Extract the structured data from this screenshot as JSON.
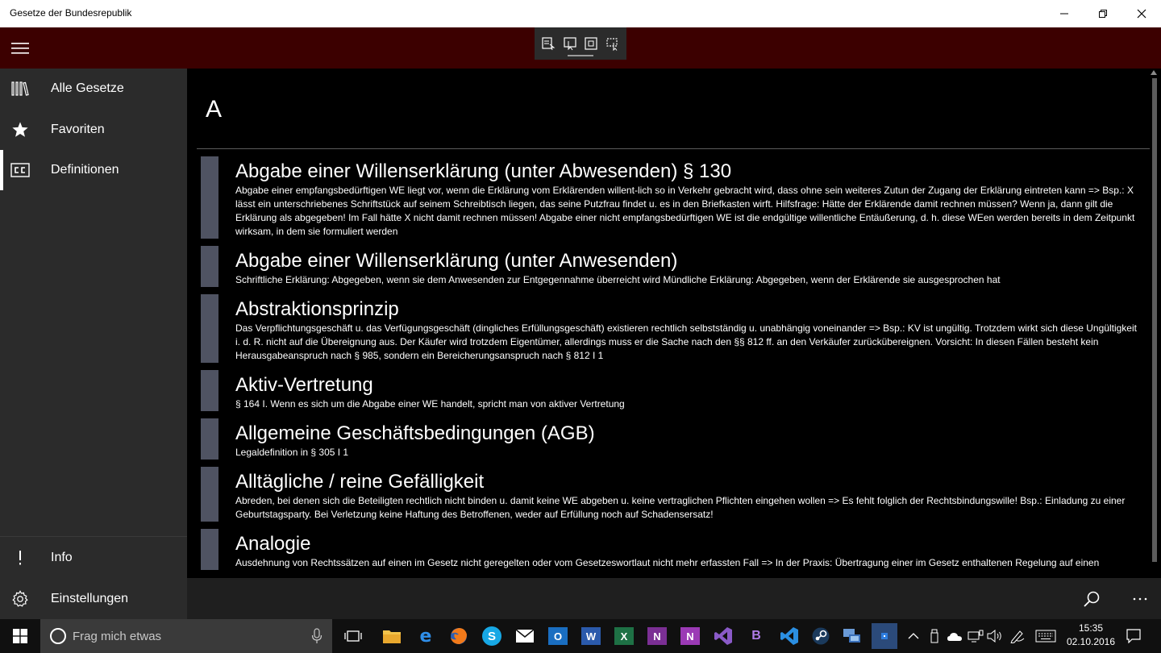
{
  "window": {
    "title": "Gesetze der Bundesrepublik"
  },
  "sidebar": {
    "items": [
      {
        "label": "Alle Gesetze",
        "icon": "library-icon"
      },
      {
        "label": "Favoriten",
        "icon": "star-icon"
      },
      {
        "label": "Definitionen",
        "icon": "closed-caption-icon",
        "active": true
      }
    ],
    "footer": [
      {
        "label": "Info",
        "icon": "info-icon"
      },
      {
        "label": "Einstellungen",
        "icon": "gear-icon"
      }
    ]
  },
  "main": {
    "section_letter": "A",
    "entries": [
      {
        "title": "Abgabe einer Willenserklärung (unter Abwesenden) § 130",
        "description": "Abgabe einer empfangsbedürftigen WE liegt vor, wenn die Erklärung vom Erklärenden willent-lich so in Verkehr gebracht wird, dass ohne sein weiteres Zutun der Zugang der Erklärung eintreten kann => Bsp.: X lässt ein unterschriebenes Schriftstück auf seinem Schreibtisch liegen, das seine Putzfrau findet u. es in den Briefkasten wirft. Hilfsfrage: Hätte der Erklärende damit rechnen müssen? Wenn ja, dann gilt die Erklärung als abgegeben! Im Fall hätte X nicht damit rechnen müssen! Abgabe einer nicht empfangsbedürftigen WE ist die endgültige willentliche Entäußerung, d. h. diese WEen werden bereits in dem Zeitpunkt wirksam, in dem sie formuliert werden"
      },
      {
        "title": "Abgabe einer Willenserklärung (unter Anwesenden)",
        "description": "Schriftliche Erklärung: Abgegeben, wenn sie dem Anwesenden zur Entgegennahme überreicht wird Mündliche Erklärung: Abgegeben, wenn der Erklärende sie ausgesprochen hat"
      },
      {
        "title": "Abstraktionsprinzip",
        "description": "Das Verpflichtungsgeschäft u. das Verfügungsgeschäft (dingliches Erfüllungsgeschäft) existieren rechtlich selbstständig u. unabhängig voneinander => Bsp.: KV ist ungültig. Trotzdem wirkt sich diese Ungültigkeit i. d. R. nicht auf die Übereignung aus. Der Käufer wird trotzdem Eigentümer, allerdings muss er die Sache nach den §§ 812 ff. an den Verkäufer zurückübereignen. Vorsicht: In diesen Fällen besteht kein Herausgabeanspruch nach § 985, sondern ein Bereicherungsanspruch nach § 812 I 1"
      },
      {
        "title": "Aktiv-Vertretung",
        "description": "§ 164 I. Wenn es sich um die Abgabe einer WE handelt, spricht man von aktiver Vertretung"
      },
      {
        "title": "Allgemeine Geschäftsbedingungen (AGB)",
        "description": "Legaldefinition in § 305 I 1"
      },
      {
        "title": "Alltägliche / reine Gefälligkeit",
        "description": "Abreden, bei denen sich die Beteiligten rechtlich nicht binden u. damit keine WE abgeben u. keine vertraglichen Pflichten eingehen wollen => Es fehlt folglich der Rechtsbindungswille! Bsp.: Einladung zu einer Geburtstagsparty. Bei Verletzung keine Haftung des Betroffenen, weder auf Erfüllung noch auf Schadensersatz!"
      },
      {
        "title": "Analogie",
        "description": "Ausdehnung von Rechtssätzen auf einen im Gesetz nicht geregelten oder vom Gesetzeswortlaut nicht mehr erfassten Fall => In der Praxis: Übertragung einer im Gesetz enthaltenen Regelung auf einen"
      }
    ]
  },
  "taskbar": {
    "search_placeholder": "Frag mich etwas",
    "clock_time": "15:35",
    "clock_date": "02.10.2016",
    "apps": [
      {
        "label": "",
        "icon": "task-view-icon"
      },
      {
        "label": "",
        "icon": "file-explorer-icon"
      },
      {
        "label": "e",
        "icon": "edge-icon"
      },
      {
        "label": "",
        "icon": "firefox-icon"
      },
      {
        "label": "S",
        "icon": "skype-icon"
      },
      {
        "label": "",
        "icon": "mail-icon"
      },
      {
        "label": "O",
        "icon": "outlook-icon"
      },
      {
        "label": "W",
        "icon": "word-icon"
      },
      {
        "label": "X",
        "icon": "excel-icon"
      },
      {
        "label": "N",
        "icon": "onenote-icon"
      },
      {
        "label": "N",
        "icon": "onenote-2016-icon"
      },
      {
        "label": "",
        "icon": "visual-studio-icon"
      },
      {
        "label": "B",
        "icon": "blend-icon"
      },
      {
        "label": "",
        "icon": "vs-code-icon"
      },
      {
        "label": "",
        "icon": "steam-icon"
      },
      {
        "label": "",
        "icon": "network-icon"
      },
      {
        "label": "",
        "icon": "gesetze-app-icon"
      }
    ]
  },
  "colors": {
    "header": "#3c0000",
    "sidebar": "#2b2b2b",
    "entry_bar": "#4f5362",
    "background": "#000000"
  }
}
